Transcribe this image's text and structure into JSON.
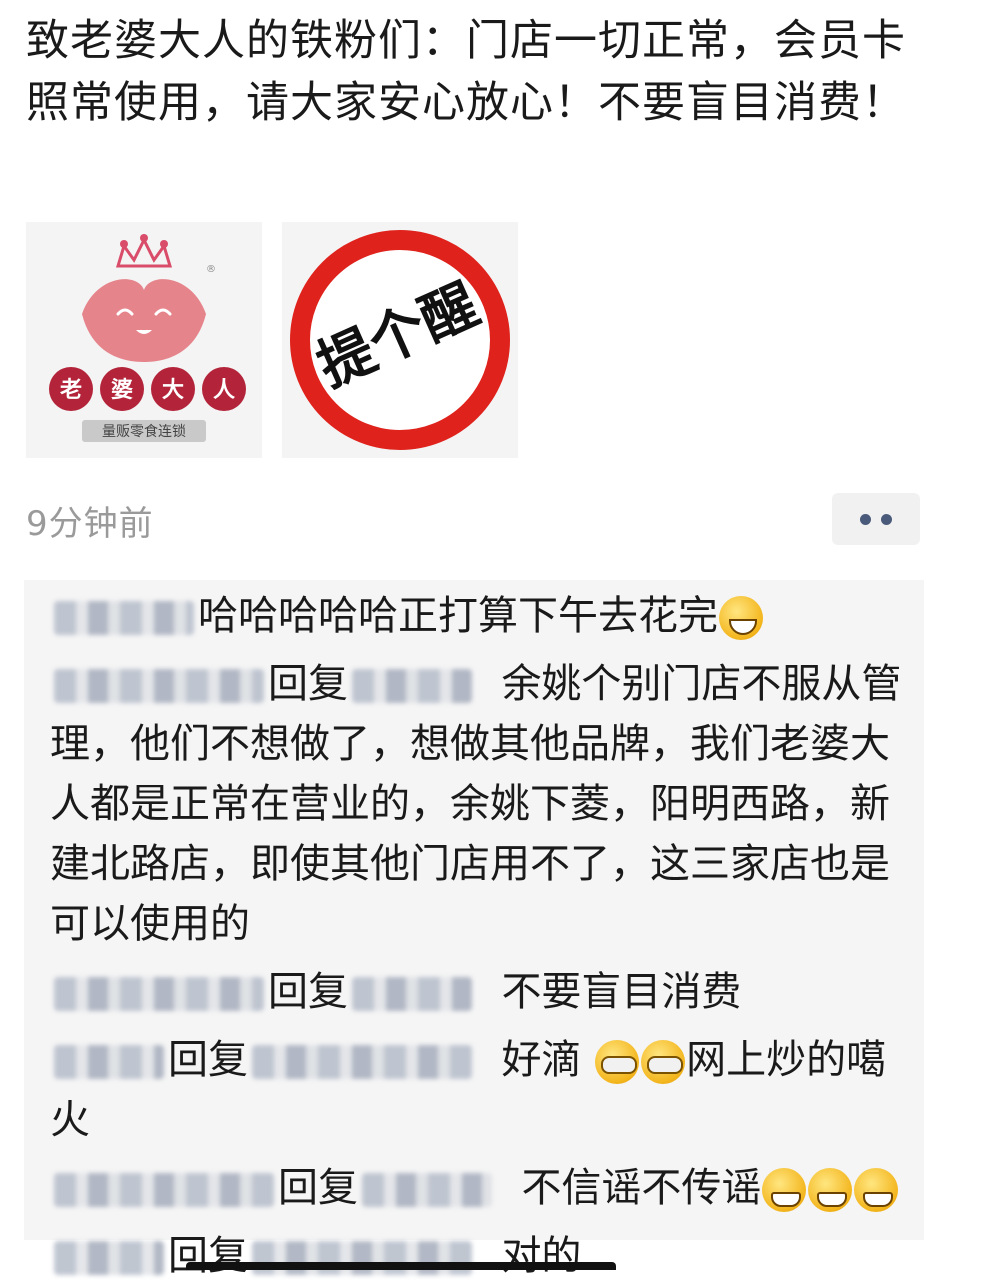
{
  "post": {
    "text": "致老婆大人的铁粉们：门店一切正常，会员卡照常使用，请大家安心放心！不要盲目消费！",
    "logo": {
      "brand": "老婆大人",
      "tagline": "量贩零食连锁",
      "registered": "®"
    },
    "warning_sign": {
      "text": "提个醒"
    },
    "timestamp": "9分钟前"
  },
  "comments": [
    {
      "text": "哈哈哈哈哈正打算下午去花完",
      "emoji": [
        "laugh-icon"
      ]
    },
    {
      "reply_label": "回复",
      "text": "余姚个别门店不服从管理，他们不想做了，想做其他品牌，我们老婆大人都是正常在营业的，余姚下菱，阳明西路，新建北路店，即使其他门店用不了，这三家店也是可以使用的"
    },
    {
      "reply_label": "回复",
      "text": "不要盲目消费"
    },
    {
      "reply_label": "回复",
      "text_before": "好滴",
      "text_after": "网上炒的噶火",
      "emoji": [
        "cry-laugh-icon",
        "cry-laugh-icon"
      ]
    },
    {
      "reply_label": "回复",
      "text": "不信谣不传谣",
      "emoji": [
        "grin-icon",
        "grin-icon",
        "grin-icon"
      ]
    },
    {
      "reply_label": "回复",
      "text": "对的"
    }
  ],
  "colors": {
    "warning_red": "#e0221c",
    "logo_pink": "#e6848c",
    "logo_red": "#b3243a",
    "link_blue": "#4a5a7a"
  }
}
